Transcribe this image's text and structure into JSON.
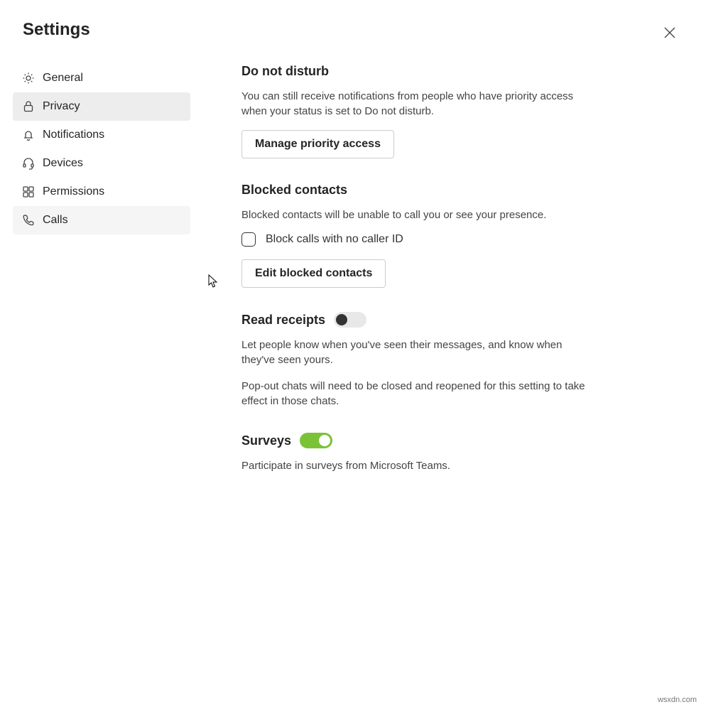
{
  "header": {
    "title": "Settings"
  },
  "sidebar": {
    "items": [
      {
        "label": "General"
      },
      {
        "label": "Privacy"
      },
      {
        "label": "Notifications"
      },
      {
        "label": "Devices"
      },
      {
        "label": "Permissions"
      },
      {
        "label": "Calls"
      }
    ]
  },
  "dnd": {
    "title": "Do not disturb",
    "desc": "You can still receive notifications from people who have priority access when your status is set to Do not disturb.",
    "button": "Manage priority access"
  },
  "blocked": {
    "title": "Blocked contacts",
    "desc": "Blocked contacts will be unable to call you or see your presence.",
    "checkbox_label": "Block calls with no caller ID",
    "checkbox_checked": false,
    "button": "Edit blocked contacts"
  },
  "read_receipts": {
    "title": "Read receipts",
    "toggle": false,
    "desc1": "Let people know when you've seen their messages, and know when they've seen yours.",
    "desc2": "Pop-out chats will need to be closed and reopened for this setting to take effect in those chats."
  },
  "surveys": {
    "title": "Surveys",
    "toggle": true,
    "desc": "Participate in surveys from Microsoft Teams."
  },
  "watermark": "wsxdn.com"
}
